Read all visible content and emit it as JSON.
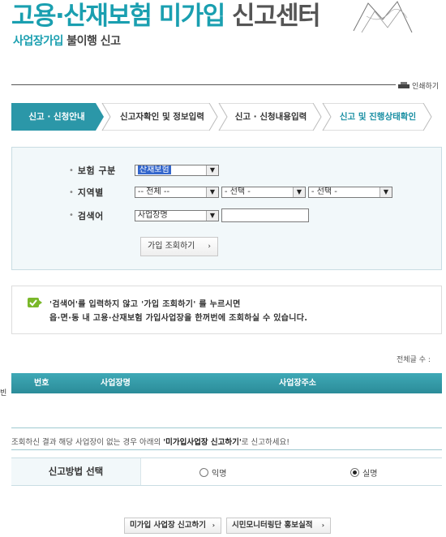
{
  "header": {
    "title_part1": "고용·산재보험 미가입",
    "title_part2": "신고센터",
    "subtitle_part1": "사업장가입",
    "subtitle_part2": "불이행 신고"
  },
  "print_label": "인쇄하기",
  "steps": [
    {
      "label": "신고 · 신청안내"
    },
    {
      "label": "신고자확인 및 정보입력"
    },
    {
      "label": "신고 · 신청내용입력"
    },
    {
      "label": "신고 및 진행상태확인"
    }
  ],
  "search": {
    "insurance_label": "보험 구분",
    "insurance_value": "산재보험",
    "region_label": "지역별",
    "region_selects": [
      "-- 전체 --",
      "- 선택 -",
      "- 선택 -"
    ],
    "keyword_label": "검색어",
    "keyword_type_value": "사업장명",
    "keyword_value": "",
    "search_button": "가입 조회하기"
  },
  "info": {
    "line1": "'검색어'를 입력하지 않고 '가입 조회하기' 를 누르시면",
    "line2": "읍·면·동 내 고용·산재보험 가입사업장을 한꺼번에 조회하실 수 있습니다."
  },
  "total_label": "전체글 수 :",
  "table": {
    "columns": [
      "번호",
      "사업장명",
      "사업장주소"
    ]
  },
  "edge_label": "빈",
  "notice": {
    "before": "조회하신 결과 해당 사업장이 없는 경우 아래의 ",
    "bold": "'미가입사업장 신고하기'",
    "after": "로 신고하세요!"
  },
  "method": {
    "label": "신고방법 선택",
    "options": [
      {
        "label": "익명",
        "selected": false
      },
      {
        "label": "실명",
        "selected": true
      }
    ]
  },
  "buttons": {
    "report": "미가입 사업장 신고하기",
    "monitoring": "시민모니터링단 홍보실적"
  },
  "colors": {
    "accent": "#1a9fb0",
    "step_active": "#2b97a8",
    "table_header": "#3399a6"
  }
}
